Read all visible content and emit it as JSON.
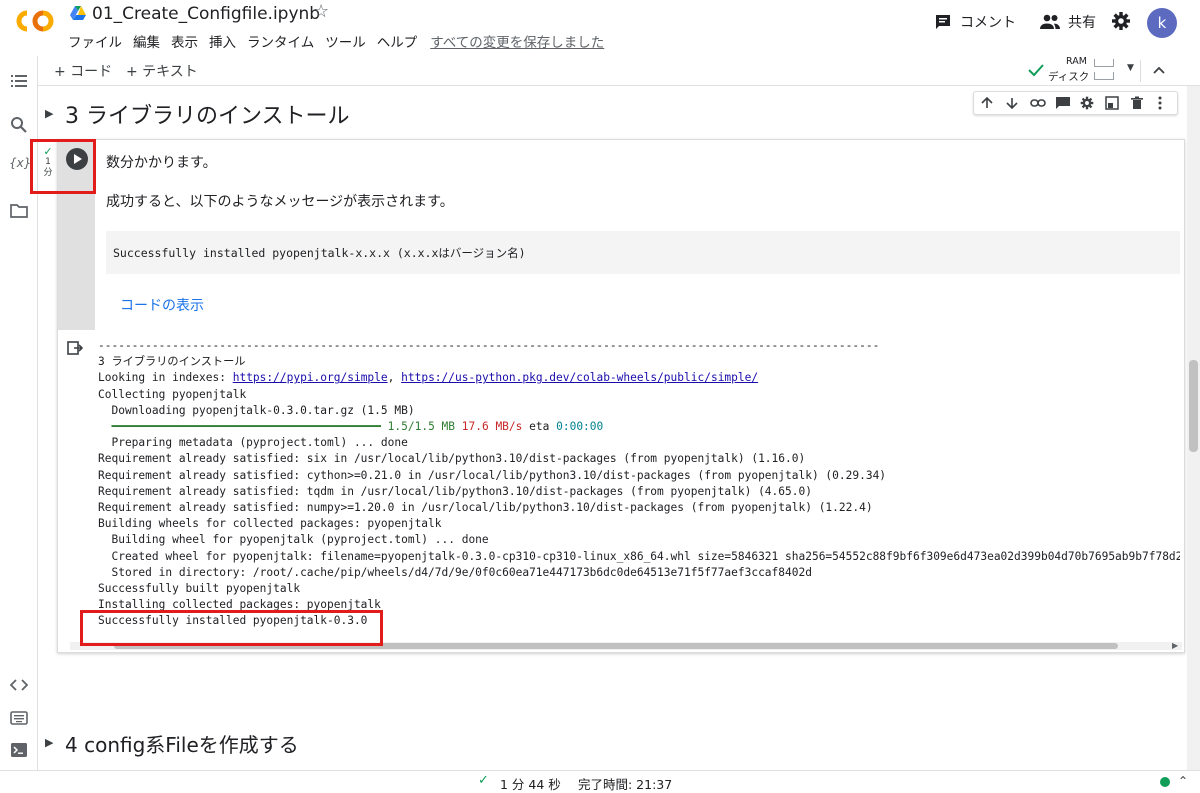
{
  "header": {
    "title": "01_Create_Configfile.ipynb",
    "menu": [
      "ファイル",
      "編集",
      "表示",
      "挿入",
      "ランタイム",
      "ツール",
      "ヘルプ"
    ],
    "saved_status": "すべての変更を保存しました",
    "comment_label": "コメント",
    "share_label": "共有",
    "avatar_letter": "k"
  },
  "toolbar": {
    "add_code": "+ コード",
    "add_text": "+ テキスト",
    "ram_label": "RAM",
    "disk_label": "ディスク"
  },
  "sections": {
    "s3_title": "3 ライブラリのインストール",
    "s4_title": "4 config系Fileを作成する"
  },
  "cell": {
    "exec_check": "✓",
    "exec_count": "1",
    "exec_unit": "分",
    "md_line1": "数分かかります。",
    "md_line2": "成功すると、以下のようなメッセージが表示されます。",
    "code_example": "Successfully installed pyopenjtalk-x.x.x (x.x.xはバージョン名)",
    "show_code": "コードの表示"
  },
  "output": {
    "lines": [
      "--------------------------------------------------------------------------------------------------------------------",
      "3 ライブラリのインストール",
      "Looking in indexes: ",
      "Collecting pyopenjtalk",
      "  Downloading pyopenjtalk-0.3.0.tar.gz (1.5 MB)",
      "",
      "  Preparing metadata (pyproject.toml) ... done",
      "Requirement already satisfied: six in /usr/local/lib/python3.10/dist-packages (from pyopenjtalk) (1.16.0)",
      "Requirement already satisfied: cython>=0.21.0 in /usr/local/lib/python3.10/dist-packages (from pyopenjtalk) (0.29.34)",
      "Requirement already satisfied: tqdm in /usr/local/lib/python3.10/dist-packages (from pyopenjtalk) (4.65.0)",
      "Requirement already satisfied: numpy>=1.20.0 in /usr/local/lib/python3.10/dist-packages (from pyopenjtalk) (1.22.4)",
      "Building wheels for collected packages: pyopenjtalk",
      "  Building wheel for pyopenjtalk (pyproject.toml) ... done",
      "  Created wheel for pyopenjtalk: filename=pyopenjtalk-0.3.0-cp310-cp310-linux_x86_64.whl size=5846321 sha256=54552c88f9bf6f309e6d473ea02d399b04d70b7695ab9b7f78d21075",
      "  Stored in directory: /root/.cache/pip/wheels/d4/7d/9e/0f0c60ea71e447173b6dc0de64513e71f5f77aef3ccaf8402d",
      "Successfully built pyopenjtalk",
      "Installing collected packages: pyopenjtalk",
      "Successfully installed pyopenjtalk-0.3.0"
    ],
    "link1": "https://pypi.org/simple",
    "link_sep": ", ",
    "link2": "https://us-python.pkg.dev/colab-wheels/public/simple/",
    "progress_bar": "━━━━━━━━━━━━━━━━━━━━━━━━━━━━━━━━━━━━━━━━",
    "progress_size": "1.5/1.5 MB",
    "progress_speed": "17.6 MB/s",
    "progress_eta_label": "eta",
    "progress_eta": "0:00:00"
  },
  "status": {
    "check": "✓",
    "elapsed": "1 分 44 秒",
    "completed": "完了時間: 21:37"
  },
  "colors": {
    "highlight_box": "#e21b1b",
    "link": "#1a73e8",
    "status_green": "#0f9d58"
  }
}
